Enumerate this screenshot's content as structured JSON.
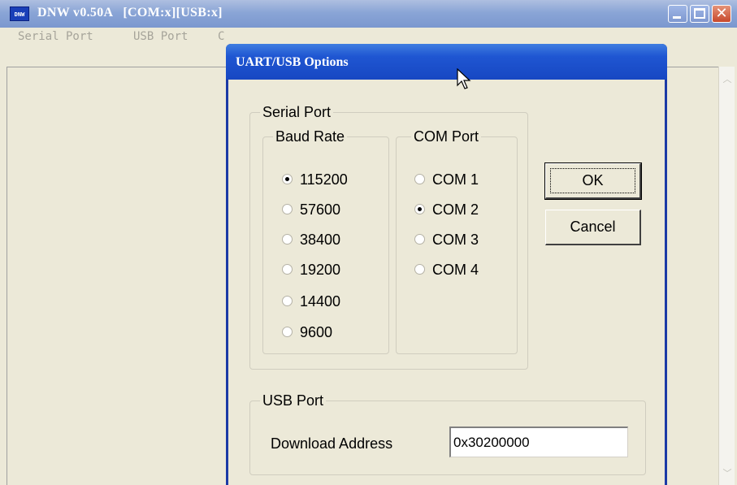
{
  "main_window": {
    "icon_text": "DNW",
    "title": "DNW v0.50A   [COM:x][USB:x]",
    "menu": [
      "Serial Port",
      "USB Port",
      "C"
    ]
  },
  "dialog": {
    "title": "UART/USB Options",
    "serial_port": {
      "label": "Serial Port",
      "baud_rate": {
        "label": "Baud Rate",
        "options": [
          "115200",
          "57600",
          "38400",
          "19200",
          "14400",
          "9600"
        ],
        "selected": "115200"
      },
      "com_port": {
        "label": "COM Port",
        "options": [
          "COM 1",
          "COM 2",
          "COM 3",
          "COM 4"
        ],
        "selected": "COM 2"
      }
    },
    "ok_label": "OK",
    "cancel_label": "Cancel",
    "usb_port": {
      "label": "USB Port",
      "download_address_label": "Download Address",
      "download_address_value": "0x30200000"
    }
  },
  "colors": {
    "dialog_title_blue": "#1f56d2",
    "window_face": "#ece9d8",
    "close_button_red": "#c7482c"
  },
  "icons": [
    "dnw-app-icon",
    "minimize-icon",
    "maximize-icon",
    "close-icon",
    "scroll-up-icon",
    "scroll-down-icon",
    "mouse-cursor-icon"
  ]
}
